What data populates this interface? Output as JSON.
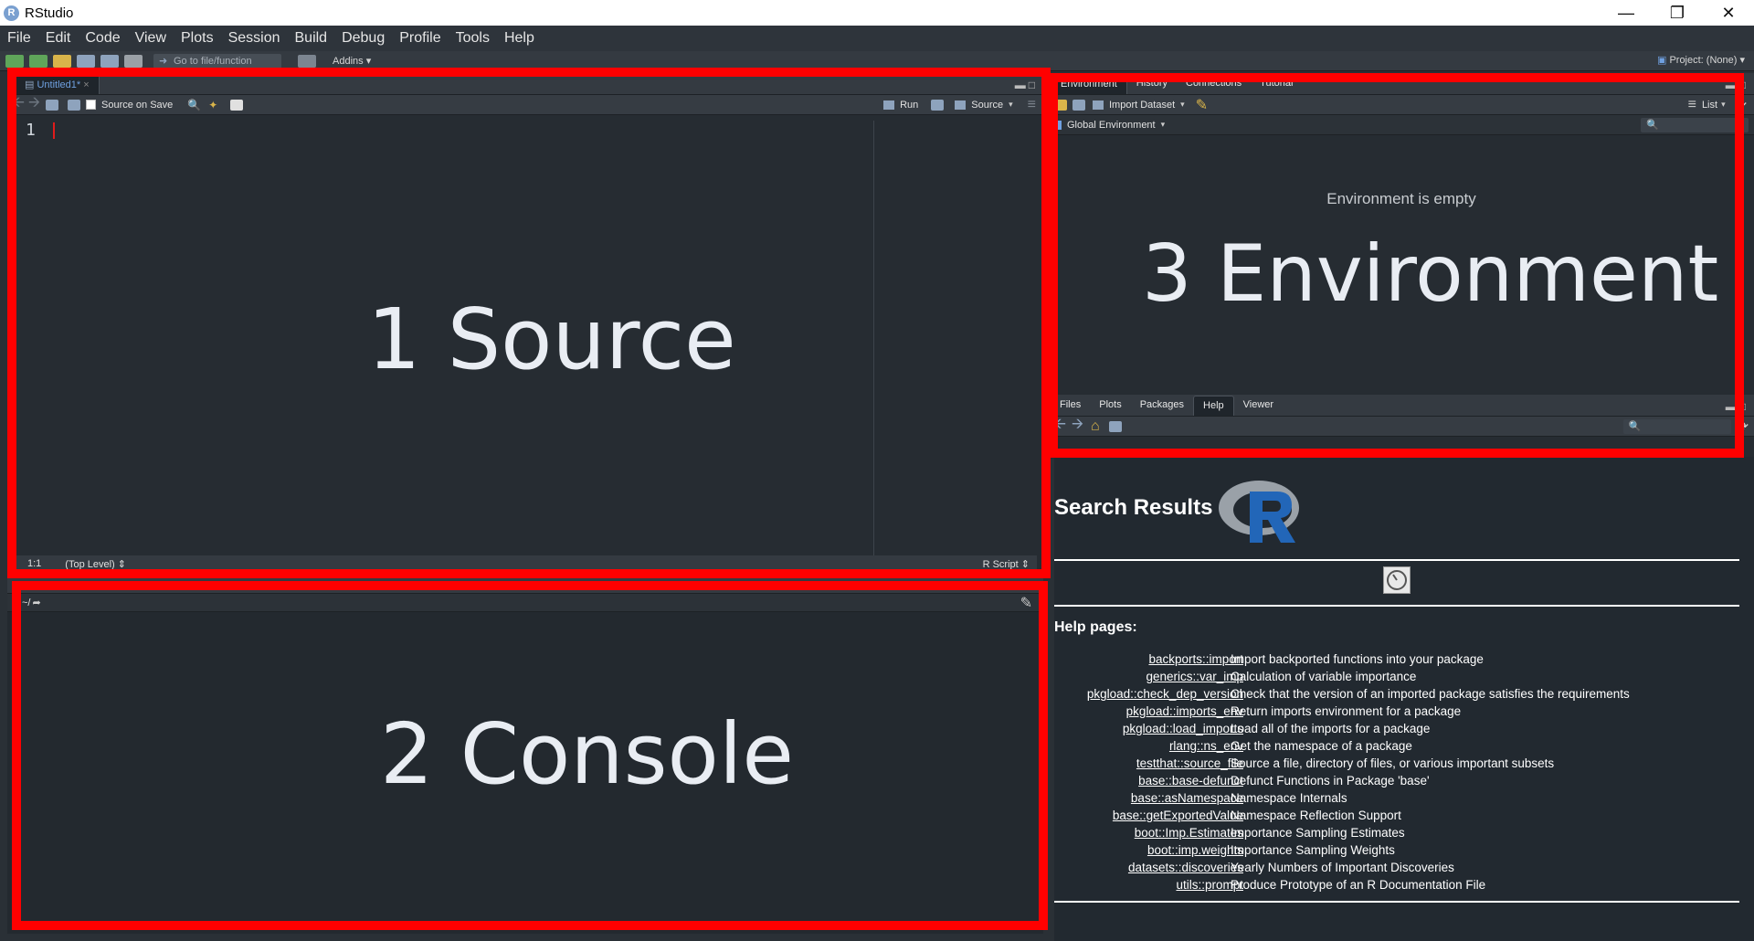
{
  "window": {
    "title": "RStudio",
    "app_icon": "R",
    "controls": [
      "minimize",
      "restore",
      "close"
    ]
  },
  "menu": [
    "File",
    "Edit",
    "Code",
    "View",
    "Plots",
    "Session",
    "Build",
    "Debug",
    "Profile",
    "Tools",
    "Help"
  ],
  "toolbar": {
    "goto_placeholder": "Go to file/function",
    "addins": "Addins",
    "project": "Project: (None)"
  },
  "source": {
    "tab": "Untitled1*",
    "source_on_save": "Source on Save",
    "run": "Run",
    "source": "Source",
    "line_number": "1",
    "status_position": "1:1",
    "status_scope": "(Top Level)",
    "status_type": "R Script",
    "big_label": "1 Source"
  },
  "console": {
    "path": "~/",
    "big_label": "2 Console"
  },
  "environment": {
    "tabs": [
      "Environment",
      "History",
      "Connections",
      "Tutorial"
    ],
    "import_dataset": "Import Dataset",
    "list": "List",
    "global_env": "Global Environment",
    "empty_message": "Environment is empty",
    "big_label": "3 Environment"
  },
  "files": {
    "tabs": [
      "Files",
      "Plots",
      "Packages",
      "Help",
      "Viewer"
    ],
    "active_tab": "Help"
  },
  "help": {
    "title": "Search Results",
    "pages_header": "Help pages:",
    "rows": [
      {
        "link": "backports::import",
        "desc": "Import backported functions into your package"
      },
      {
        "link": "generics::var_imp",
        "desc": "Calculation of variable importance"
      },
      {
        "link": "pkgload::check_dep_version",
        "desc": "Check that the version of an imported package satisfies the requirements"
      },
      {
        "link": "pkgload::imports_env",
        "desc": "Return imports environment for a package"
      },
      {
        "link": "pkgload::load_imports",
        "desc": "Load all of the imports for a package"
      },
      {
        "link": "rlang::ns_env",
        "desc": "Get the namespace of a package"
      },
      {
        "link": "testthat::source_file",
        "desc": "Source a file, directory of files, or various important subsets"
      },
      {
        "link": "base::base-defunct",
        "desc": "Defunct Functions in Package 'base'"
      },
      {
        "link": "base::asNamespace",
        "desc": "Namespace Internals"
      },
      {
        "link": "base::getExportedValue",
        "desc": "Namespace Reflection Support"
      },
      {
        "link": "boot::Imp.Estimates",
        "desc": "Importance Sampling Estimates"
      },
      {
        "link": "boot::imp.weights",
        "desc": "Importance Sampling Weights"
      },
      {
        "link": "datasets::discoveries",
        "desc": "Yearly Numbers of Important Discoveries"
      },
      {
        "link": "utils::prompt",
        "desc": "Produce Prototype of an R Documentation File"
      }
    ]
  },
  "colors": {
    "highlight_box": "#ff0000",
    "pane_bg": "#262c32",
    "r_logo_blue": "#2266b8"
  }
}
